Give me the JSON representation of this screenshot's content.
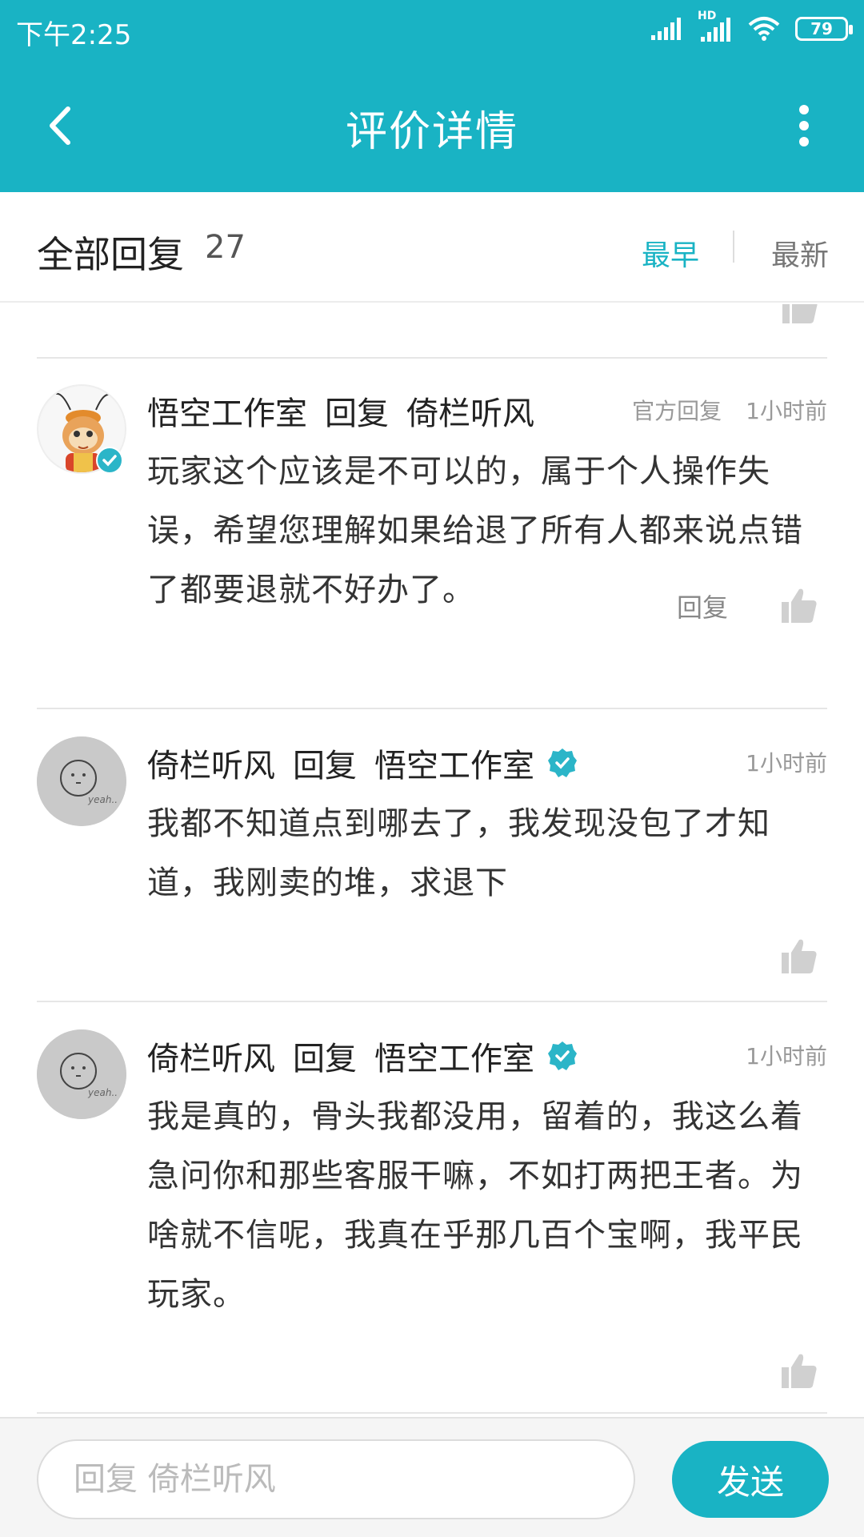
{
  "status_bar": {
    "time": "下午2:25",
    "network_label": "HD",
    "battery": "79"
  },
  "nav": {
    "title": "评价详情",
    "back_icon": "chevron-left-icon",
    "more_icon": "more-vertical-icon"
  },
  "filter": {
    "title": "全部回复",
    "count": "27",
    "sort_earliest": "最早",
    "sort_newest": "最新",
    "active_sort": "最早"
  },
  "comments": [
    {
      "author": "悟空工作室",
      "reply_word": "回复",
      "target": "倚栏听风",
      "badge": "官方回复",
      "time": "1小时前",
      "body": "玩家这个应该是不可以的，属于个人操作失误，希望您理解如果给退了所有人都来说点错了都要退就不好办了。",
      "reply_label": "回复",
      "avatar": "monkey-king-avatar",
      "author_verified": true
    },
    {
      "author": "倚栏听风",
      "reply_word": "回复",
      "target": "悟空工作室",
      "time": "1小时前",
      "body": "我都不知道点到哪去了，我发现没包了才知道，我刚卖的堆，求退下",
      "avatar": "default-face-avatar",
      "avatar_caption": "yeah..",
      "target_verified": true
    },
    {
      "author": "倚栏听风",
      "reply_word": "回复",
      "target": "悟空工作室",
      "time": "1小时前",
      "body": "我是真的，骨头我都没用，留着的，我这么着急问你和那些客服干嘛，不如打两把王者。为啥就不信呢，我真在乎那几百个宝啊，我平民玩家。",
      "avatar": "default-face-avatar",
      "avatar_caption": "yeah..",
      "target_verified": true
    }
  ],
  "composer": {
    "placeholder": "回复 倚栏听风",
    "value": "",
    "send_label": "发送"
  },
  "colors": {
    "accent": "#19b3c4",
    "verified": "#2bb5c8",
    "muted_text": "#999999"
  }
}
